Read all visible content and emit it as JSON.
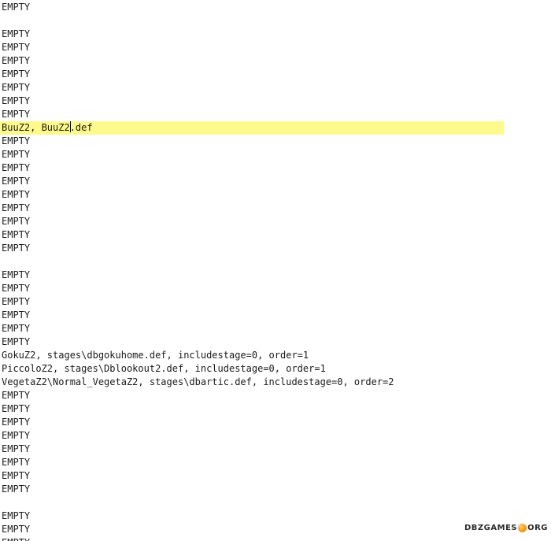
{
  "editor": {
    "highlight_color": "#fdf98a",
    "lines": [
      {
        "text": "EMPTY"
      },
      {
        "text": ""
      },
      {
        "text": "EMPTY"
      },
      {
        "text": "EMPTY"
      },
      {
        "text": "EMPTY"
      },
      {
        "text": "EMPTY"
      },
      {
        "text": "EMPTY"
      },
      {
        "text": "EMPTY"
      },
      {
        "text": "EMPTY"
      },
      {
        "text": "BuuZ2, BuuZ2.def",
        "current": true,
        "caret_after": 12
      },
      {
        "text": "EMPTY"
      },
      {
        "text": "EMPTY"
      },
      {
        "text": "EMPTY"
      },
      {
        "text": "EMPTY"
      },
      {
        "text": "EMPTY"
      },
      {
        "text": "EMPTY"
      },
      {
        "text": "EMPTY"
      },
      {
        "text": "EMPTY"
      },
      {
        "text": "EMPTY"
      },
      {
        "text": ""
      },
      {
        "text": "EMPTY"
      },
      {
        "text": "EMPTY"
      },
      {
        "text": "EMPTY"
      },
      {
        "text": "EMPTY"
      },
      {
        "text": "EMPTY"
      },
      {
        "text": "EMPTY"
      },
      {
        "text": "GokuZ2, stages\\dbgokuhome.def, includestage=0, order=1"
      },
      {
        "text": "PiccoloZ2, stages\\Dblookout2.def, includestage=0, order=1"
      },
      {
        "text": "VegetaZ2\\Normal_VegetaZ2, stages\\dbartic.def, includestage=0, order=2"
      },
      {
        "text": "EMPTY"
      },
      {
        "text": "EMPTY"
      },
      {
        "text": "EMPTY"
      },
      {
        "text": "EMPTY"
      },
      {
        "text": "EMPTY"
      },
      {
        "text": "EMPTY"
      },
      {
        "text": "EMPTY"
      },
      {
        "text": "EMPTY"
      },
      {
        "text": ""
      },
      {
        "text": "EMPTY"
      },
      {
        "text": "EMPTY"
      },
      {
        "text": "EMPTY"
      }
    ]
  },
  "watermark": {
    "left": "DBZGAMES",
    "right": "ORG"
  }
}
